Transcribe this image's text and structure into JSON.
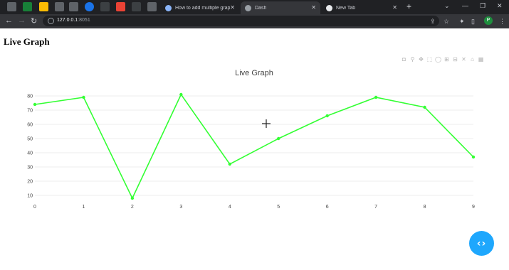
{
  "browser": {
    "tabs": [
      {
        "label": "How to add multiple grap",
        "favicon_color": "#8ab4f8"
      },
      {
        "label": "Dash",
        "favicon_color": "#9aa0a6"
      },
      {
        "label": "New Tab",
        "favicon_color": "#e8eaed"
      }
    ],
    "url_host": "127.0.0.1",
    "url_port": ":8051"
  },
  "page": {
    "title": "Live Graph"
  },
  "chart_data": {
    "type": "line",
    "title": "Live Graph",
    "x": [
      0,
      1,
      2,
      3,
      4,
      5,
      6,
      7,
      8,
      9
    ],
    "series": [
      {
        "values": [
          74,
          79,
          8,
          81,
          32,
          50,
          66,
          79,
          72,
          37
        ],
        "color": "#33ff33"
      }
    ],
    "xlim": [
      0,
      9
    ],
    "ylim": [
      7,
      82
    ],
    "yticks": [
      10,
      20,
      30,
      40,
      50,
      60,
      70,
      80
    ],
    "xticks": [
      0,
      1,
      2,
      3,
      4,
      5,
      6,
      7,
      8,
      9
    ],
    "grid": true,
    "grid_color": "#eeeeee"
  },
  "accent_color": "#1ea7fd"
}
